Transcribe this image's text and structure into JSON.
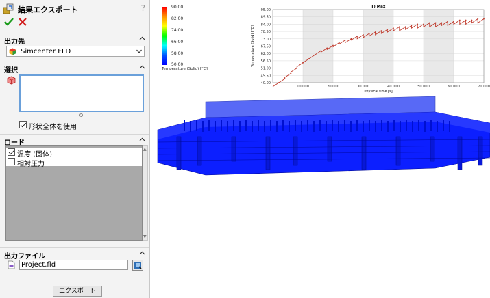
{
  "panel": {
    "title": "結果エクスポート",
    "help": "?",
    "sections": {
      "output_target": "出力先",
      "selection": "選択",
      "load": "ロード",
      "output_file": "出力ファイル"
    },
    "target_combo_value": "Simcenter FLD",
    "whole_shape_checkbox_label": "形状全体を使用",
    "whole_shape_checked": true,
    "loads": [
      {
        "label": "温度 (固体)",
        "checked": true
      },
      {
        "label": "相対圧力",
        "checked": false
      }
    ],
    "file_name": "Project.fld",
    "export_button": "エクスポート"
  },
  "legend": {
    "title": "Temperature (Solid) [°C]",
    "ticks": [
      "90.00",
      "82.00",
      "74.00",
      "66.00",
      "58.00",
      "50.00"
    ]
  },
  "chart_data": {
    "type": "line",
    "title": "T) Max",
    "xlabel": "Physical time [s]",
    "ylabel": "Temperature (Solid) [°C]",
    "xlim": [
      0,
      70000
    ],
    "ylim": [
      40,
      95
    ],
    "xticks": [
      "10.000",
      "20.000",
      "30.000",
      "40.000",
      "50.000",
      "60.000",
      "70.000"
    ],
    "yticks": [
      "40.00",
      "45.50",
      "51.00",
      "56.50",
      "62.00",
      "67.50",
      "73.00",
      "78.50",
      "84.00",
      "89.50",
      "95.00"
    ],
    "grid": true,
    "series": [
      {
        "color": "#c0392b",
        "x": [
          2000,
          4000,
          6000,
          8000,
          10000,
          12000,
          14000,
          16000,
          18000,
          20000,
          22000,
          24000,
          26000,
          28000,
          30000,
          32000,
          34000,
          36000,
          38000,
          40000,
          42000,
          44000,
          46000,
          48000,
          50000,
          52000,
          54000,
          56000,
          58000,
          60000,
          62000,
          64000,
          66000,
          68000,
          70000
        ],
        "y": [
          40,
          43,
          47,
          51,
          55,
          58,
          61,
          64,
          66,
          68,
          70,
          72,
          73,
          75,
          76,
          77,
          78,
          79,
          80,
          81,
          82,
          82,
          83,
          84,
          84,
          85,
          85,
          85,
          86,
          86,
          87,
          87,
          87,
          88,
          88
        ]
      }
    ]
  },
  "colors": {
    "panel_bg": "#f3f3f3",
    "model_blue": "#0000ff",
    "selection_border": "#6aa0da",
    "series": "#c0392b"
  }
}
